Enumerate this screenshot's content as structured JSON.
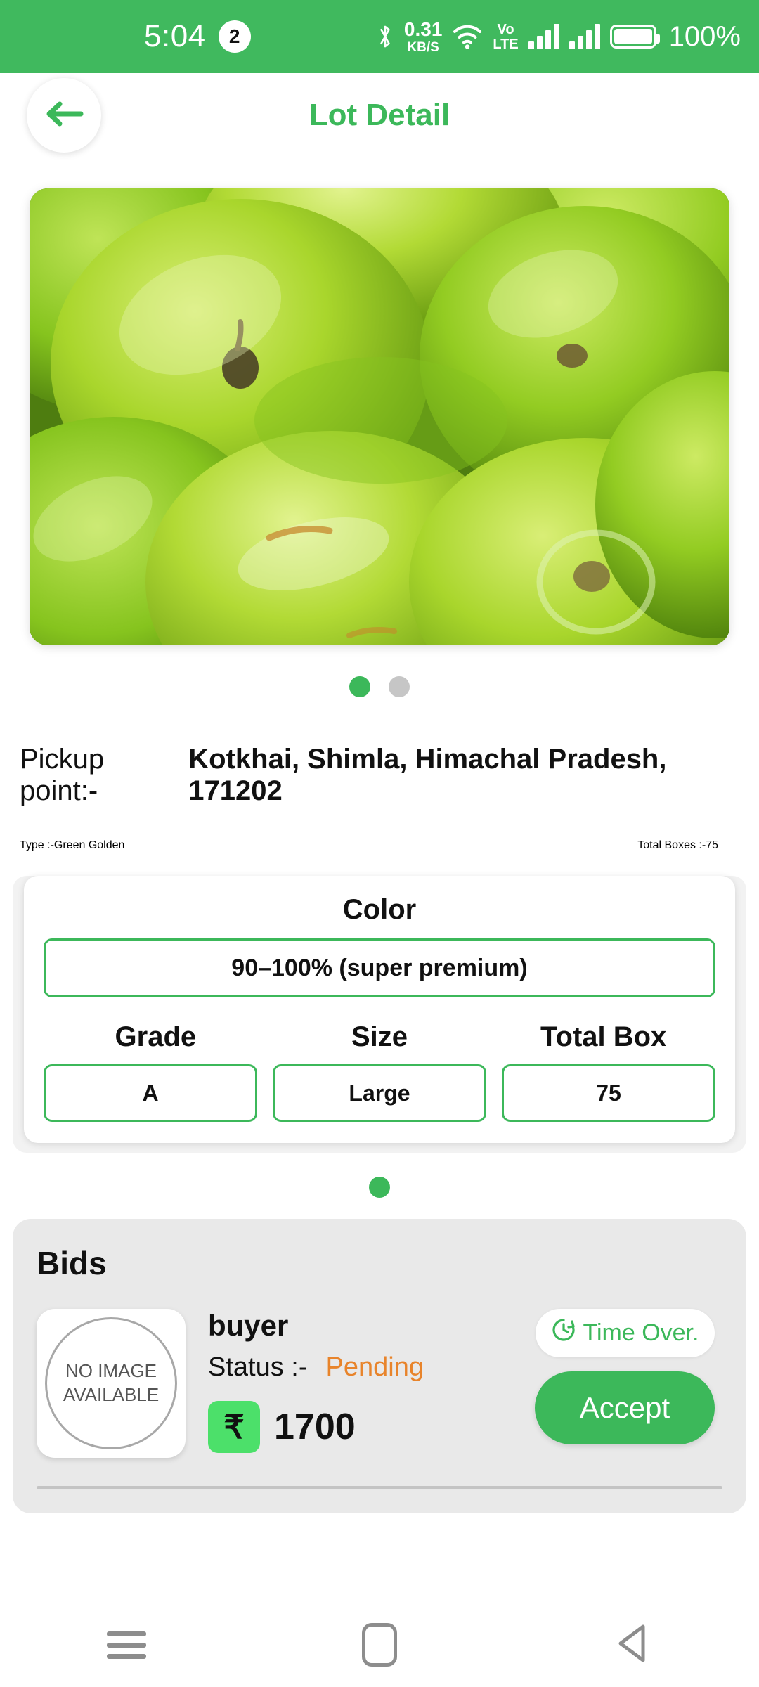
{
  "status_bar": {
    "time": "5:04",
    "notification_count": "2",
    "network_speed_value": "0.31",
    "network_speed_unit": "KB/S",
    "volte_top": "Vo",
    "volte_bottom": "LTE",
    "battery_percent": "100%",
    "background_color": "#40B95E"
  },
  "header": {
    "title": "Lot Detail",
    "title_color": "#3CB85A",
    "back_icon": "arrow-left-icon"
  },
  "gallery": {
    "image_alt": "green apples",
    "dots": [
      {
        "active": true
      },
      {
        "active": false
      }
    ]
  },
  "details": {
    "pickup_label": "Pickup point:-",
    "pickup_value": "Kotkhai, Shimla, Himachal Pradesh, 171202",
    "type_label": "Type  :-",
    "type_value": "Green Golden",
    "total_boxes_label": "Total Boxes  :-",
    "total_boxes_value": "75"
  },
  "color_card": {
    "color_header": "Color",
    "color_value": "90–100% (super premium)",
    "columns": [
      "Grade",
      "Size",
      "Total Box"
    ],
    "values": [
      "A",
      "Large",
      "75"
    ],
    "border_color": "#3CB85A",
    "page_dot_active": true
  },
  "bids": {
    "section_title": "Bids",
    "items": [
      {
        "avatar_line1": "NO IMAGE",
        "avatar_line2": "AVAILABLE",
        "name": "buyer",
        "status_label": "Status  :-",
        "status_value": "Pending",
        "status_color": "#E8842B",
        "currency_symbol": "₹",
        "amount": "1700",
        "time_badge": "Time Over.",
        "time_badge_icon": "clock-history-icon",
        "accept_label": "Accept",
        "accept_color": "#3CB85A"
      }
    ]
  },
  "navbar": {
    "recents_icon": "menu-icon",
    "home_icon": "home-square-icon",
    "back_icon": "triangle-back-icon"
  }
}
